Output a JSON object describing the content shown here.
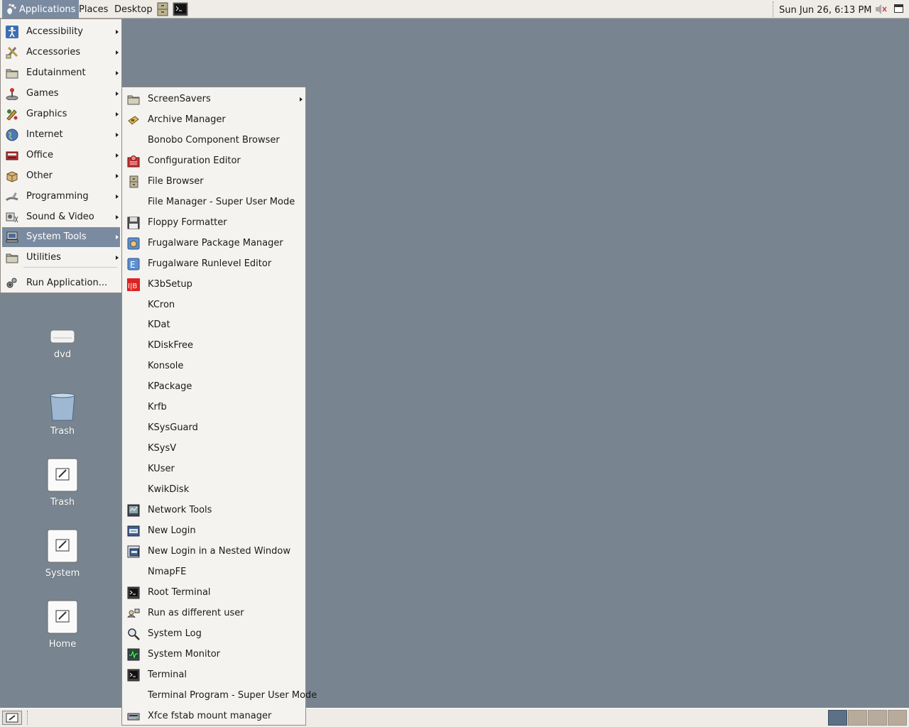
{
  "top_panel": {
    "applications": "Applications",
    "places": "Places",
    "desktop": "Desktop",
    "clock": "Sun Jun 26,  6:13 PM"
  },
  "desktop_icons": [
    {
      "label": "dvd",
      "icon": "drive-icon"
    },
    {
      "label": "Trash",
      "icon": "trash-icon"
    },
    {
      "label": "Trash",
      "icon": "document-icon"
    },
    {
      "label": "System",
      "icon": "document-icon"
    },
    {
      "label": "Home",
      "icon": "document-icon"
    }
  ],
  "applications_menu": {
    "items": [
      {
        "label": "Accessibility",
        "icon": "accessibility-icon",
        "submenu": true
      },
      {
        "label": "Accessories",
        "icon": "accessories-icon",
        "submenu": true
      },
      {
        "label": "Edutainment",
        "icon": "folder-icon",
        "submenu": true
      },
      {
        "label": "Games",
        "icon": "joystick-icon",
        "submenu": true
      },
      {
        "label": "Graphics",
        "icon": "graphics-icon",
        "submenu": true
      },
      {
        "label": "Internet",
        "icon": "globe-icon",
        "submenu": true
      },
      {
        "label": "Office",
        "icon": "office-icon",
        "submenu": true
      },
      {
        "label": "Other",
        "icon": "box-icon",
        "submenu": true
      },
      {
        "label": "Programming",
        "icon": "programming-icon",
        "submenu": true
      },
      {
        "label": "Sound & Video",
        "icon": "sound-video-icon",
        "submenu": true
      },
      {
        "label": "System Tools",
        "icon": "computer-icon",
        "submenu": true,
        "highlighted": true
      },
      {
        "label": "Utilities",
        "icon": "folder-icon",
        "submenu": true
      }
    ],
    "run_application": "Run Application..."
  },
  "system_tools_menu": {
    "items": [
      {
        "label": "ScreenSavers",
        "icon": "folder-icon",
        "submenu": true
      },
      {
        "label": "Archive Manager",
        "icon": "archive-icon"
      },
      {
        "label": "Bonobo Component Browser",
        "icon": ""
      },
      {
        "label": "Configuration Editor",
        "icon": "config-editor-icon"
      },
      {
        "label": "File Browser",
        "icon": "file-browser-icon"
      },
      {
        "label": "File Manager - Super User Mode",
        "icon": ""
      },
      {
        "label": "Floppy Formatter",
        "icon": "floppy-icon"
      },
      {
        "label": "Frugalware Package Manager",
        "icon": "package-manager-icon"
      },
      {
        "label": "Frugalware Runlevel Editor",
        "icon": "runlevel-icon"
      },
      {
        "label": "K3bSetup",
        "icon": "k3b-icon"
      },
      {
        "label": "KCron",
        "icon": ""
      },
      {
        "label": "KDat",
        "icon": ""
      },
      {
        "label": "KDiskFree",
        "icon": ""
      },
      {
        "label": "Konsole",
        "icon": ""
      },
      {
        "label": "KPackage",
        "icon": ""
      },
      {
        "label": "Krfb",
        "icon": ""
      },
      {
        "label": "KSysGuard",
        "icon": ""
      },
      {
        "label": "KSysV",
        "icon": ""
      },
      {
        "label": "KUser",
        "icon": ""
      },
      {
        "label": "KwikDisk",
        "icon": ""
      },
      {
        "label": "Network Tools",
        "icon": "network-tools-icon"
      },
      {
        "label": "New Login",
        "icon": "login-icon"
      },
      {
        "label": "New Login in a Nested Window",
        "icon": "nested-login-icon"
      },
      {
        "label": "NmapFE",
        "icon": ""
      },
      {
        "label": "Root Terminal",
        "icon": "terminal-icon"
      },
      {
        "label": "Run as different user",
        "icon": "run-as-icon"
      },
      {
        "label": "System Log",
        "icon": "magnifier-icon"
      },
      {
        "label": "System Monitor",
        "icon": "monitor-icon"
      },
      {
        "label": "Terminal",
        "icon": "terminal-icon"
      },
      {
        "label": "Terminal Program - Super User Mode",
        "icon": ""
      },
      {
        "label": "Xfce fstab mount manager",
        "icon": "mount-manager-icon"
      }
    ]
  },
  "colors": {
    "desktop_bg": "#788591",
    "panel_bg": "#efebe6",
    "menu_bg": "#f5f3f0",
    "highlight": "#7a8ba1"
  }
}
